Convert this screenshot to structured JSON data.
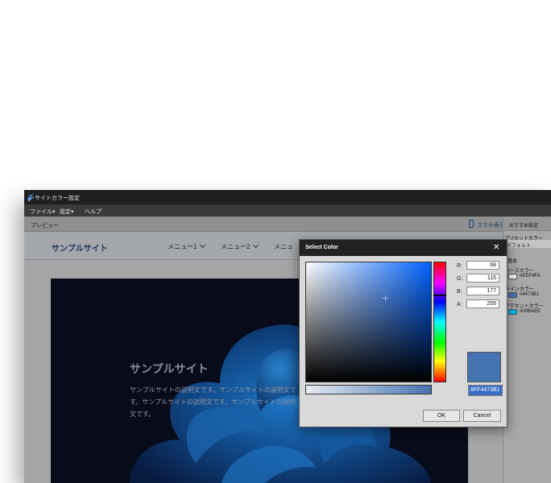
{
  "window": {
    "title": "サイトカラー設定",
    "menu": [
      "ファイル▾",
      "設定▾",
      "ヘルプ"
    ]
  },
  "preview_bar": {
    "label": "プレビュー",
    "mobile_label": "スマホ表示"
  },
  "site": {
    "logo": "サンプルサイト",
    "nav": [
      "メニュー1",
      "メニュー2",
      "メニュ"
    ],
    "hero_title": "サンプルサイト",
    "hero_desc": "サンプルサイトの説明文です。サンプルサイトの説明文です。サンプルサイトの説明文です。サンプルサイトの説明文です。"
  },
  "right_panel": {
    "title": "おすすめ設定",
    "preset_label": "プリセットカラー",
    "preset_value": "デフォルト",
    "basic_label": "基本",
    "swatches": [
      {
        "label": "ベースカラー",
        "hex": "#EEF4FA",
        "color": "#EEF4FA"
      },
      {
        "label": "メインカラー",
        "hex": "#4473B1",
        "color": "#4473B1"
      },
      {
        "label": "アクセントカラー",
        "hex": "#00BAEE",
        "color": "#00BAEE"
      }
    ]
  },
  "dialog": {
    "title": "Select Color",
    "close": "✕",
    "channels": [
      {
        "label": "R:",
        "value": "68"
      },
      {
        "label": "G:",
        "value": "115"
      },
      {
        "label": "B:",
        "value": "177"
      },
      {
        "label": "A:",
        "value": "255"
      }
    ],
    "hex": "#FF4473B1",
    "preview_color": "#4473B1",
    "ok_label": "OK",
    "cancel_label": "Cancel"
  }
}
